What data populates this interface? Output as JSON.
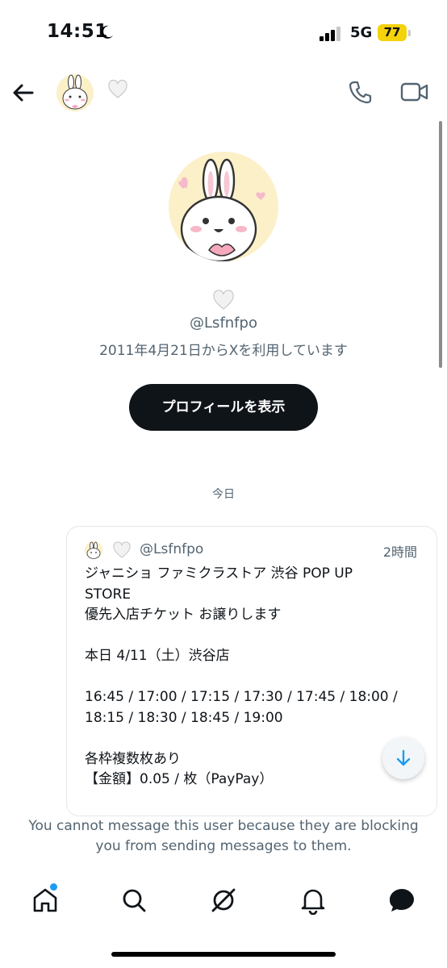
{
  "status": {
    "time": "14:51",
    "network": "5G",
    "battery": "77"
  },
  "header": {
    "heart": "🤍"
  },
  "profile": {
    "heart": "🤍",
    "handle": "@Lsfnfpo",
    "joined": "2011年4月21日からXを利用しています",
    "view_button": "プロフィールを表示"
  },
  "conversation": {
    "date_label": "今日",
    "card": {
      "heart": "🤍",
      "handle": "@Lsfnfpo",
      "time": "2時間",
      "lines": [
        "ジャニショ ファミクラストア 渋谷 POP UP",
        "STORE",
        "優先入店チケット お譲りします",
        "",
        "本日 4/11（土）渋谷店",
        "",
        "16:45 / 17:00 / 17:15 / 17:30 / 17:45 / 18:00 /",
        "18:15 / 18:30 / 18:45 / 19:00",
        "",
        "各枠複数枚あり",
        "【金額】0.05 / 枚（PayPay）"
      ]
    }
  },
  "blocked_notice": "You cannot message this user because they are blocking you from sending messages to them.",
  "colors": {
    "accent": "#1d9bf0",
    "text": "#0f1419",
    "secondary": "#536471",
    "battery": "#f4d20c"
  },
  "bottom_nav": [
    "home-icon",
    "search-icon",
    "grok-icon",
    "bell-icon",
    "messages-icon"
  ]
}
